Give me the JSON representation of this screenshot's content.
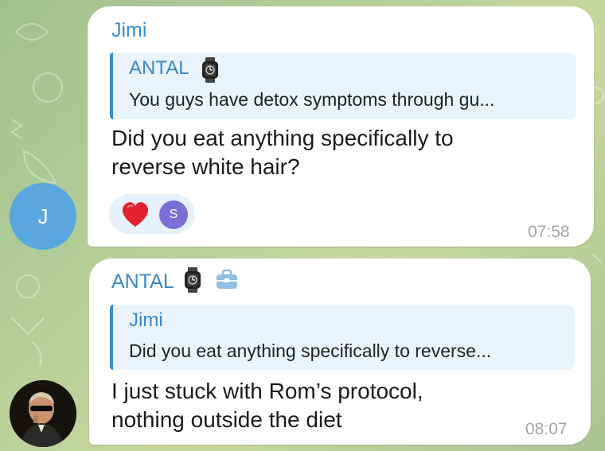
{
  "colors": {
    "accent": "#3d8fd1",
    "name_jimi": "#3a88c8",
    "name_antal": "#3a88c8",
    "bubble": "#ffffff",
    "reply_bg": "#e9f3fb",
    "time": "#a2a6aa",
    "avatar_j": "#5aa7e0",
    "reaction_avatar": "#7b6fd6"
  },
  "messages": [
    {
      "sender": "Jimi",
      "reply": {
        "name": "ANTAL",
        "badge_icon": "watch-icon",
        "text": "You guys have detox symptoms through gu..."
      },
      "text_line1": "Did you eat anything specifically to",
      "text_line2": "reverse white hair?",
      "reaction": {
        "emoji": "heart",
        "user_initial": "S"
      },
      "time": "07:58",
      "avatar_initial": "J"
    },
    {
      "sender": "ANTAL",
      "sender_icons": [
        "watch-icon",
        "briefcase-icon"
      ],
      "reply": {
        "name": "Jimi",
        "text": "Did you eat anything specifically to reverse..."
      },
      "text_line1": "I just stuck with Rom’s protocol,",
      "text_line2": "nothing outside the diet",
      "time": "08:07"
    }
  ]
}
